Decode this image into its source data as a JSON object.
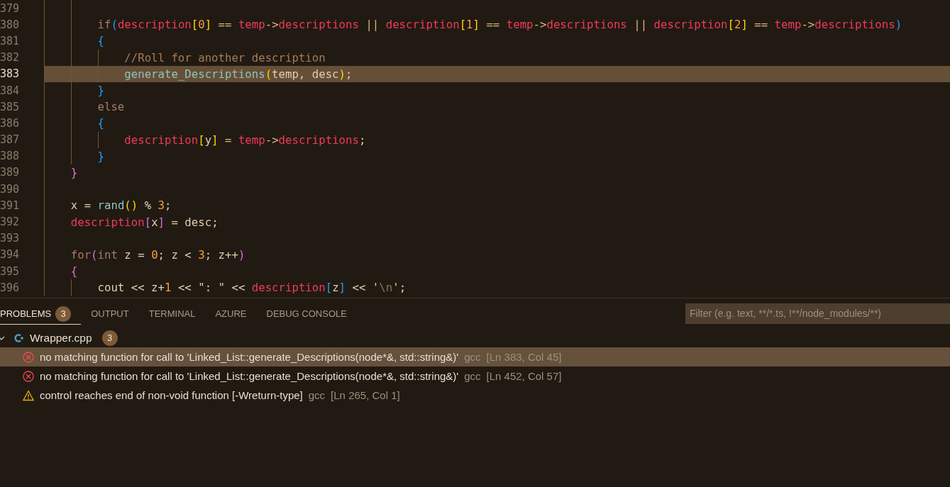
{
  "editor": {
    "code": [
      {
        "kind": "block",
        "children": [
          {
            "kind": "line",
            "number": "379",
            "highlighted": false
          },
          {
            "kind": "line",
            "number": "380",
            "highlighted": false,
            "tokens": [
              {
                "kind": "keyword",
                "text": "if"
              },
              {
                "kind": "bracket3",
                "text": "("
              },
              {
                "kind": "variable",
                "text": "description"
              },
              {
                "kind": "bracket1",
                "text": "["
              },
              {
                "kind": "number",
                "text": "0"
              },
              {
                "kind": "bracket1",
                "text": "]"
              },
              {
                "kind": "operator",
                "text": " == "
              },
              {
                "kind": "variable",
                "text": "temp"
              },
              {
                "kind": "operator",
                "text": "->"
              },
              {
                "kind": "variable",
                "text": "descriptions"
              },
              {
                "kind": "operator",
                "text": " || "
              },
              {
                "kind": "variable",
                "text": "description"
              },
              {
                "kind": "bracket1",
                "text": "["
              },
              {
                "kind": "number",
                "text": "1"
              },
              {
                "kind": "bracket1",
                "text": "]"
              },
              {
                "kind": "operator",
                "text": " == "
              },
              {
                "kind": "variable",
                "text": "temp"
              },
              {
                "kind": "operator",
                "text": "->"
              },
              {
                "kind": "variable",
                "text": "descriptions"
              },
              {
                "kind": "operator",
                "text": " || "
              },
              {
                "kind": "variable",
                "text": "description"
              },
              {
                "kind": "bracket1",
                "text": "["
              },
              {
                "kind": "number",
                "text": "2"
              },
              {
                "kind": "bracket1",
                "text": "]"
              },
              {
                "kind": "operator",
                "text": " == "
              },
              {
                "kind": "variable",
                "text": "temp"
              },
              {
                "kind": "operator",
                "text": "->"
              },
              {
                "kind": "variable",
                "text": "descriptions"
              },
              {
                "kind": "bracket3",
                "text": ")"
              }
            ]
          },
          {
            "kind": "line",
            "number": "381",
            "highlighted": false,
            "tokens": [
              {
                "kind": "bracket3",
                "text": "{"
              }
            ]
          },
          {
            "kind": "block",
            "children": [
              {
                "kind": "line",
                "number": "382",
                "highlighted": false,
                "tokens": [
                  {
                    "kind": "comment",
                    "text": "//Roll for another description"
                  }
                ]
              },
              {
                "kind": "line",
                "number": "383",
                "highlighted": true,
                "tokens": [
                  {
                    "kind": "function",
                    "text": "generate_Descriptions"
                  },
                  {
                    "kind": "bracket1",
                    "text": "("
                  },
                  {
                    "kind": "plain",
                    "text": "temp, desc"
                  },
                  {
                    "kind": "bracket1",
                    "text": ")"
                  },
                  {
                    "kind": "plain",
                    "text": ";"
                  }
                ]
              }
            ]
          },
          {
            "kind": "line",
            "number": "384",
            "highlighted": false,
            "tokens": [
              {
                "kind": "bracket3",
                "text": "}"
              }
            ]
          },
          {
            "kind": "line",
            "number": "385",
            "highlighted": false,
            "tokens": [
              {
                "kind": "keyword",
                "text": "else"
              }
            ]
          },
          {
            "kind": "line",
            "number": "386",
            "highlighted": false,
            "tokens": [
              {
                "kind": "bracket3",
                "text": "{"
              }
            ]
          },
          {
            "kind": "block",
            "children": [
              {
                "kind": "line",
                "number": "387",
                "highlighted": false,
                "tokens": [
                  {
                    "kind": "variable",
                    "text": "description"
                  },
                  {
                    "kind": "bracket1",
                    "text": "["
                  },
                  {
                    "kind": "plain",
                    "text": "y"
                  },
                  {
                    "kind": "bracket1",
                    "text": "]"
                  },
                  {
                    "kind": "operator",
                    "text": " = "
                  },
                  {
                    "kind": "variable",
                    "text": "temp"
                  },
                  {
                    "kind": "operator",
                    "text": "->"
                  },
                  {
                    "kind": "variable",
                    "text": "descriptions"
                  },
                  {
                    "kind": "plain",
                    "text": ";"
                  }
                ]
              }
            ]
          },
          {
            "kind": "line",
            "number": "388",
            "highlighted": false,
            "tokens": [
              {
                "kind": "bracket3",
                "text": "}"
              }
            ]
          }
        ]
      },
      {
        "kind": "line",
        "number": "389",
        "highlighted": false,
        "tokens": [
          {
            "kind": "bracket2",
            "text": "}"
          }
        ]
      },
      {
        "kind": "line",
        "number": "390",
        "highlighted": false
      },
      {
        "kind": "line",
        "number": "391",
        "highlighted": false,
        "tokens": [
          {
            "kind": "plain",
            "text": "x = "
          },
          {
            "kind": "function",
            "text": "rand"
          },
          {
            "kind": "bracket1",
            "text": "()"
          },
          {
            "kind": "plain",
            "text": " % "
          },
          {
            "kind": "number",
            "text": "3"
          },
          {
            "kind": "plain",
            "text": ";"
          }
        ]
      },
      {
        "kind": "line",
        "number": "392",
        "highlighted": false,
        "tokens": [
          {
            "kind": "variable",
            "text": "description"
          },
          {
            "kind": "bracket2",
            "text": "["
          },
          {
            "kind": "plain",
            "text": "x"
          },
          {
            "kind": "bracket2",
            "text": "]"
          },
          {
            "kind": "plain",
            "text": " = desc;"
          }
        ]
      },
      {
        "kind": "line",
        "number": "393",
        "highlighted": false
      },
      {
        "kind": "line",
        "number": "394",
        "highlighted": false,
        "tokens": [
          {
            "kind": "keyword",
            "text": "for"
          },
          {
            "kind": "bracket2",
            "text": "("
          },
          {
            "kind": "keyword",
            "text": "int"
          },
          {
            "kind": "plain",
            "text": " z = "
          },
          {
            "kind": "number",
            "text": "0"
          },
          {
            "kind": "plain",
            "text": "; z < "
          },
          {
            "kind": "number",
            "text": "3"
          },
          {
            "kind": "plain",
            "text": "; z++"
          },
          {
            "kind": "bracket2",
            "text": ")"
          }
        ]
      },
      {
        "kind": "line",
        "number": "395",
        "highlighted": false,
        "tokens": [
          {
            "kind": "bracket2",
            "text": "{"
          }
        ]
      },
      {
        "kind": "block",
        "children": [
          {
            "kind": "line",
            "number": "396",
            "highlighted": false,
            "tokens": [
              {
                "kind": "plain",
                "text": "cout << z+"
              },
              {
                "kind": "number",
                "text": "1"
              },
              {
                "kind": "plain",
                "text": " << "
              },
              {
                "kind": "string",
                "text": "\": \""
              },
              {
                "kind": "plain",
                "text": " << "
              },
              {
                "kind": "variable",
                "text": "description"
              },
              {
                "kind": "bracket3",
                "text": "["
              },
              {
                "kind": "plain",
                "text": "z"
              },
              {
                "kind": "bracket3",
                "text": "]"
              },
              {
                "kind": "plain",
                "text": " << "
              },
              {
                "kind": "string",
                "text": "'"
              },
              {
                "kind": "escape",
                "text": "\\n"
              },
              {
                "kind": "string",
                "text": "'"
              },
              {
                "kind": "plain",
                "text": ";"
              }
            ]
          }
        ]
      }
    ]
  },
  "panel": {
    "tabs": [
      {
        "label": "PROBLEMS",
        "selected": true,
        "badge": "3"
      },
      {
        "label": "OUTPUT",
        "selected": false
      },
      {
        "label": "TERMINAL",
        "selected": false
      },
      {
        "label": "AZURE",
        "selected": false
      },
      {
        "label": "DEBUG CONSOLE",
        "selected": false
      }
    ],
    "filter": {
      "placeholder": "Filter (e.g. text, **/*.ts, !**/node_modules/**)"
    },
    "file": {
      "name": "Wrapper.cpp",
      "count": "3",
      "expanded": true
    },
    "problems": [
      {
        "kind": "error",
        "message": "no matching function for call to 'Linked_List::generate_Descriptions(node*&, std::string&)'",
        "source": "gcc",
        "location": "[Ln 383, Col 45]",
        "selected": true
      },
      {
        "kind": "error",
        "message": "no matching function for call to 'Linked_List::generate_Descriptions(node*&, std::string&)'",
        "source": "gcc",
        "location": "[Ln 452, Col 57]",
        "selected": false
      },
      {
        "kind": "warning",
        "message": "control reaches end of non-void function [-Wreturn-type]",
        "source": "gcc",
        "location": "[Ln 265, Col 1]",
        "selected": false
      }
    ]
  }
}
